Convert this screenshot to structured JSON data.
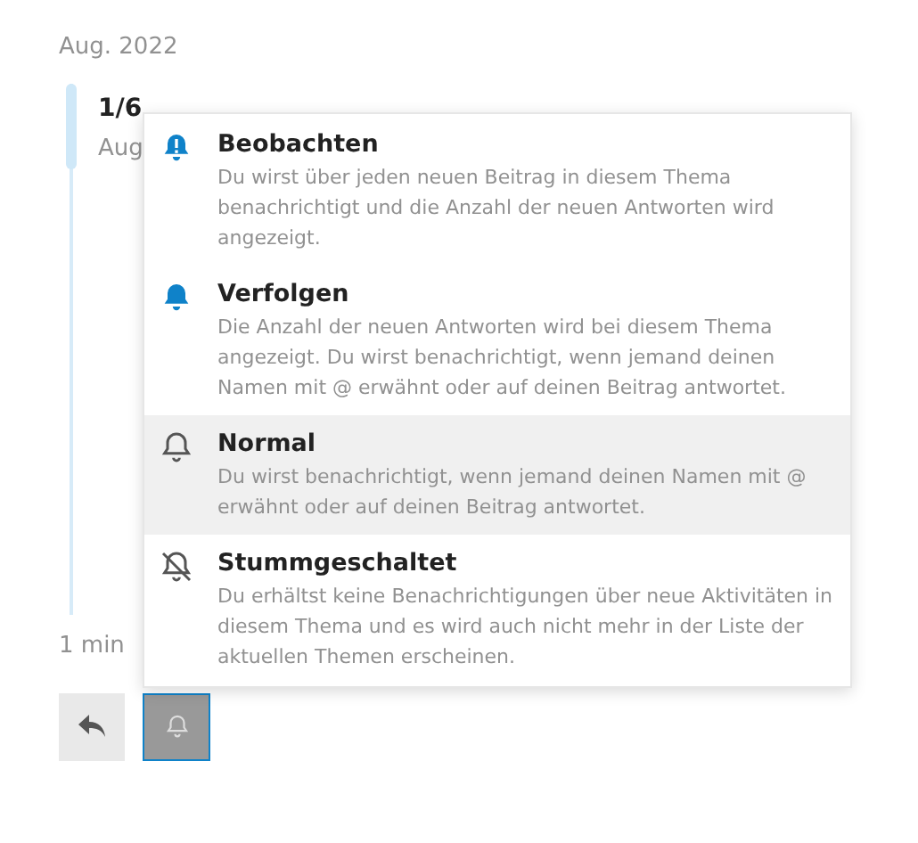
{
  "timeline": {
    "date_heading": "Aug. 2022",
    "position": "1/6",
    "position_date": "Aug",
    "last_activity": "1 min"
  },
  "notification_menu": {
    "options": [
      {
        "kind": "watching",
        "title": "Beobachten",
        "description": "Du wirst über jeden neuen Beitrag in diesem Thema benachrichtigt und die Anzahl der neuen Antworten wird angezeigt.",
        "selected": false
      },
      {
        "kind": "tracking",
        "title": "Verfolgen",
        "description": "Die Anzahl der neuen Antworten wird bei diesem Thema angezeigt. Du wirst benachrichtigt, wenn jemand deinen Namen mit @ erwähnt oder auf deinen Beitrag antwortet.",
        "selected": false
      },
      {
        "kind": "regular",
        "title": "Normal",
        "description": "Du wirst benachrichtigt, wenn jemand deinen Namen mit @ erwähnt oder auf deinen Beitrag antwortet.",
        "selected": true
      },
      {
        "kind": "muted",
        "title": "Stummgeschaltet",
        "description": "Du erhältst keine Benachrichtigungen über neue Aktivitäten in diesem Thema und es wird auch nicht mehr in der Liste der aktuellen Themen erscheinen.",
        "selected": false
      }
    ]
  }
}
